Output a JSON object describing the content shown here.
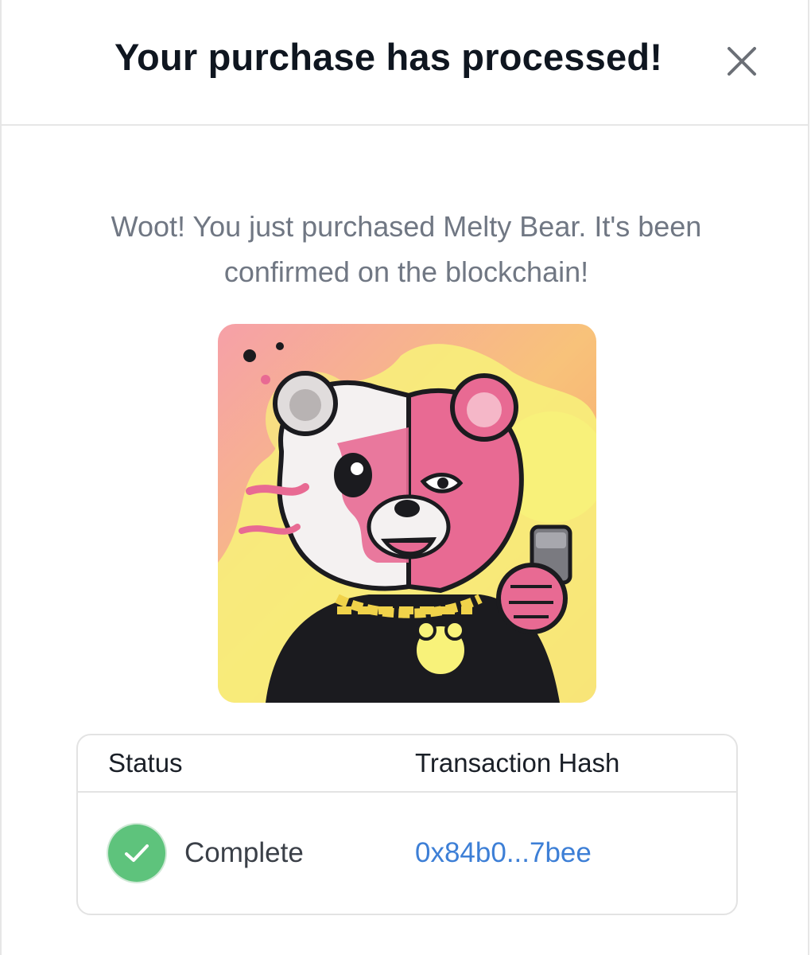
{
  "modal": {
    "title": "Your purchase has processed!",
    "close_icon": "close-icon"
  },
  "message": "Woot! You just purchased Melty Bear. It's been confirmed on the blockchain!",
  "nft": {
    "name": "Melty Bear",
    "palette": {
      "background": "#f7b36d",
      "pink": "#e86a93",
      "yellow": "#f8f27a",
      "dark": "#1b1b1f"
    }
  },
  "transaction": {
    "status_header": "Status",
    "hash_header": "Transaction Hash",
    "status": "Complete",
    "status_icon": "check-circle-icon",
    "hash": "0x84b0...7bee"
  },
  "colors": {
    "title": "#0f1620",
    "message": "#707783",
    "success": "#5ec37c",
    "link": "#3d7fd6",
    "border": "#e3e3e3"
  }
}
